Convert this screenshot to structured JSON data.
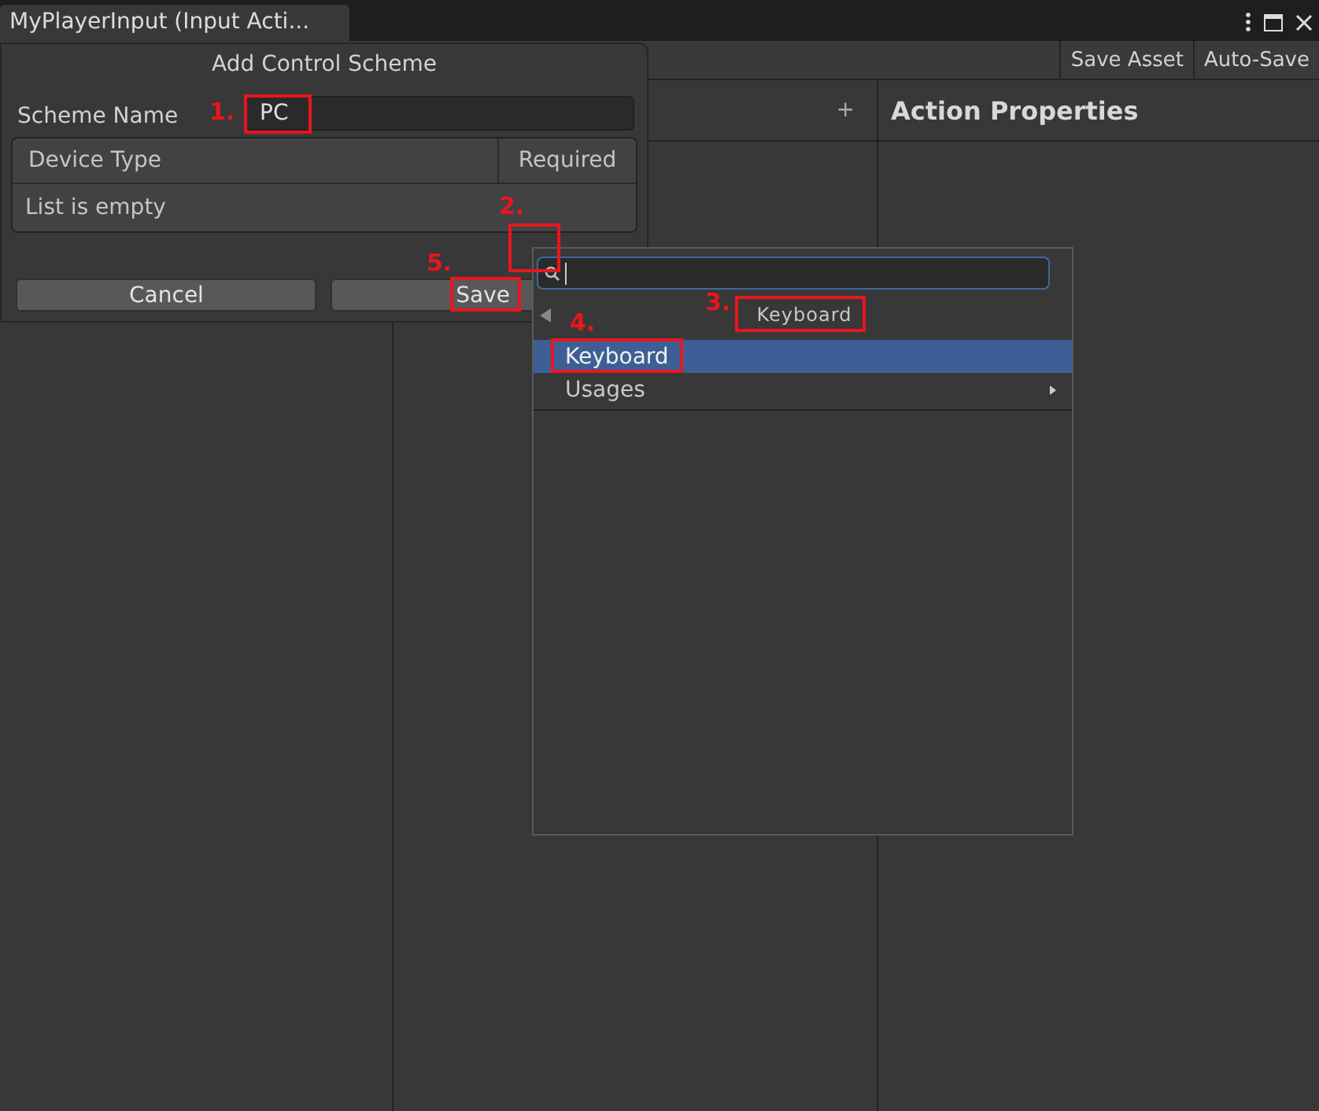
{
  "window": {
    "tab_title": "MyPlayerInput (Input Acti..."
  },
  "toolbar": {
    "buttons": [
      "Save Asset",
      "Auto-Save"
    ]
  },
  "panes": [
    {
      "kind": "add",
      "header": "+"
    },
    {
      "kind": "title",
      "header": "Action Properties"
    }
  ],
  "dialog": {
    "title": "Add Control Scheme",
    "scheme_name_label": "Scheme Name",
    "scheme_name": "PC",
    "columns": [
      "Device Type",
      "Required"
    ],
    "empty_text": "List is empty",
    "buttons": [
      "Cancel",
      "Save"
    ]
  },
  "popup": {
    "header": "Keyboard",
    "items": [
      {
        "label": "Keyboard",
        "selected": true,
        "submenu": false
      },
      {
        "label": "Usages",
        "selected": false,
        "submenu": true
      }
    ]
  },
  "annotations": [
    {
      "label": "1."
    },
    {
      "label": "2."
    },
    {
      "label": "3."
    },
    {
      "label": "4."
    },
    {
      "label": "5."
    }
  ]
}
